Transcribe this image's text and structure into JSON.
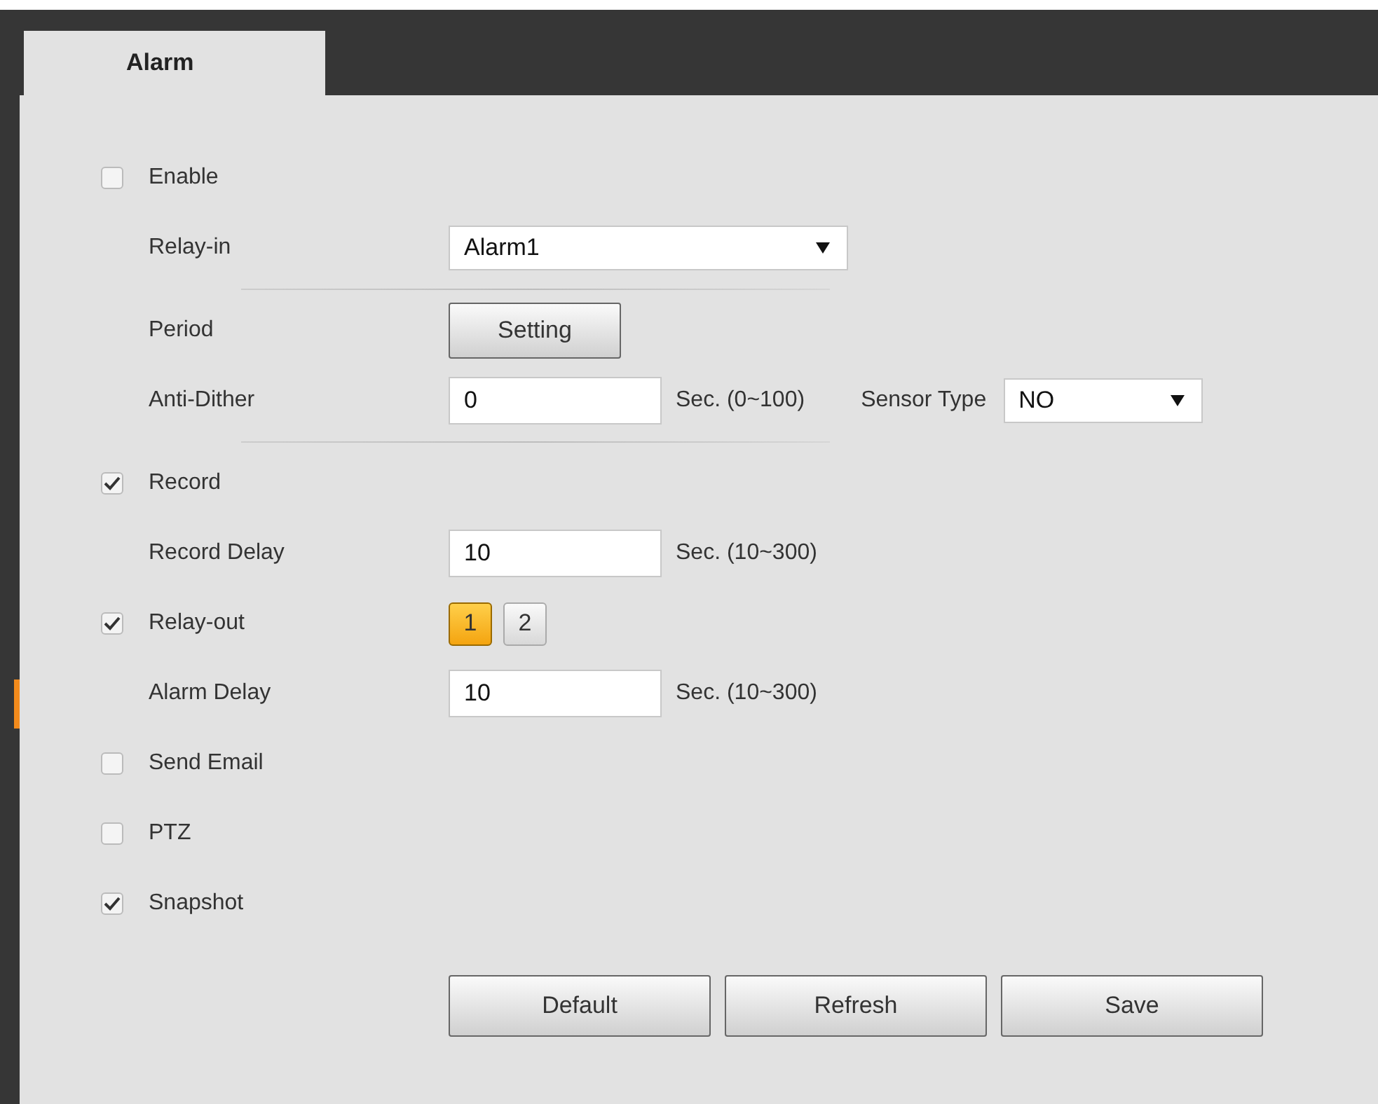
{
  "tabs": [
    {
      "label": "Alarm",
      "selected": true
    }
  ],
  "rows": [
    {
      "kind": "checkbox",
      "label": "Enable",
      "checked": false
    },
    {
      "kind": "select",
      "label": "Relay-in",
      "value": "Alarm1"
    },
    {
      "kind": "divider"
    },
    {
      "kind": "button",
      "label": "Period",
      "button": "Setting"
    },
    {
      "kind": "input",
      "label": "Anti-Dither",
      "value": "0",
      "hint": "Sec. (0~100)",
      "extra": {
        "label": "Sensor Type",
        "value": "NO"
      }
    },
    {
      "kind": "divider"
    },
    {
      "kind": "checkbox",
      "label": "Record",
      "checked": true
    },
    {
      "kind": "input",
      "label": "Record Delay",
      "value": "10",
      "hint": "Sec. (10~300)"
    },
    {
      "kind": "channels",
      "label": "Relay-out",
      "checked": true,
      "channels": [
        {
          "label": "1",
          "selected": true
        },
        {
          "label": "2",
          "selected": false
        }
      ]
    },
    {
      "kind": "input",
      "label": "Alarm Delay",
      "value": "10",
      "hint": "Sec. (10~300)"
    },
    {
      "kind": "checkbox",
      "label": "Send Email",
      "checked": false
    },
    {
      "kind": "checkbox",
      "label": "PTZ",
      "checked": false
    },
    {
      "kind": "checkbox",
      "label": "Snapshot",
      "checked": true
    }
  ],
  "buttons": [
    "Default",
    "Refresh",
    "Save"
  ]
}
